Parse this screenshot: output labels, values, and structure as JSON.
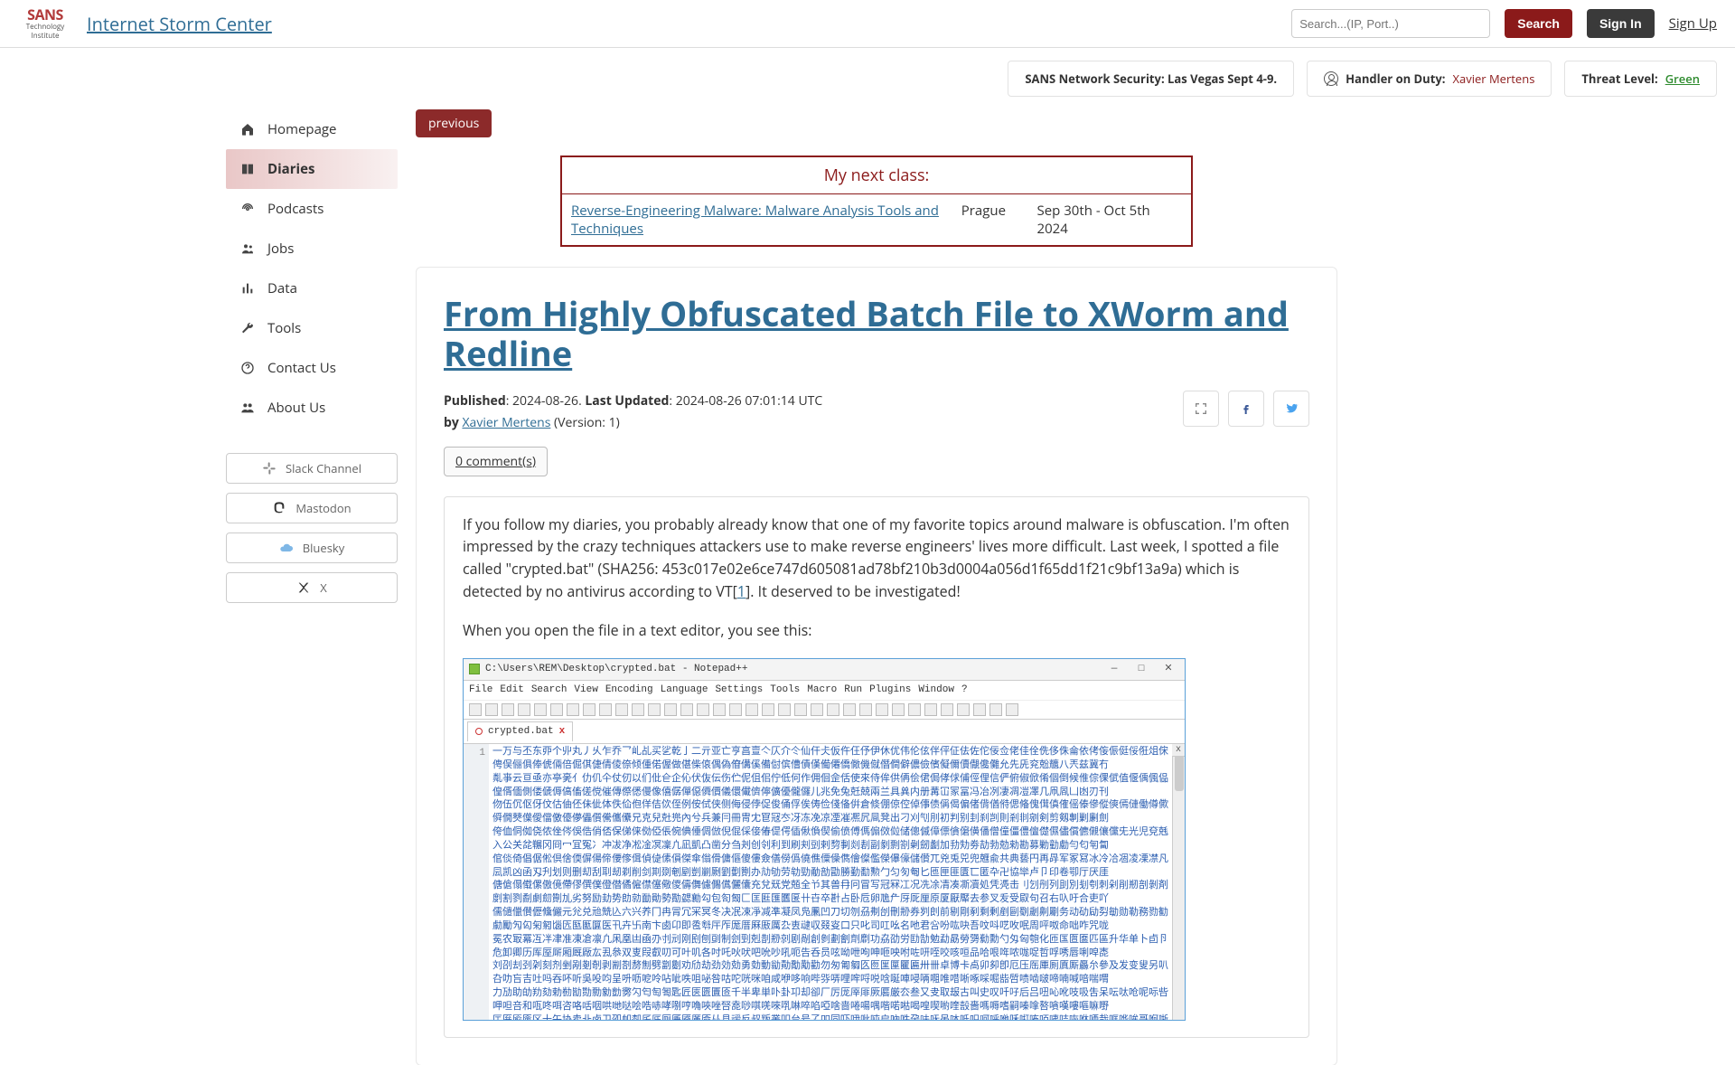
{
  "header": {
    "site_title": "Internet Storm Center",
    "logo_top": "SANS",
    "logo_mid": "Technology",
    "logo_bot": "Institute",
    "search_placeholder": "Search...(IP, Port..)",
    "search_button": "Search",
    "sign_in": "Sign In",
    "sign_up": "Sign Up"
  },
  "info_strip": {
    "promo": "SANS Network Security: Las Vegas Sept 4-9.",
    "handler_label": "Handler on Duty:",
    "handler_name": "Xavier Mertens",
    "threat_label": "Threat Level:",
    "threat_value": "Green"
  },
  "sidebar": {
    "items": [
      {
        "label": "Homepage",
        "icon": "home-icon",
        "active": false
      },
      {
        "label": "Diaries",
        "icon": "book-icon",
        "active": true
      },
      {
        "label": "Podcasts",
        "icon": "podcast-icon",
        "active": false
      },
      {
        "label": "Jobs",
        "icon": "users-icon",
        "active": false
      },
      {
        "label": "Data",
        "icon": "chart-icon",
        "active": false
      },
      {
        "label": "Tools",
        "icon": "wrench-icon",
        "active": false
      },
      {
        "label": "Contact Us",
        "icon": "question-icon",
        "active": false
      },
      {
        "label": "About Us",
        "icon": "group-icon",
        "active": false
      }
    ],
    "socials": [
      {
        "label": "Slack Channel",
        "icon": "slack-icon"
      },
      {
        "label": "Mastodon",
        "icon": "mastodon-icon"
      },
      {
        "label": "Bluesky",
        "icon": "cloud-icon"
      },
      {
        "label": "X",
        "icon": "x-icon"
      }
    ]
  },
  "nav": {
    "previous": "previous"
  },
  "class_box": {
    "heading": "My next class:",
    "course": "Reverse-Engineering Malware: Malware Analysis Tools and Techniques",
    "city": "Prague",
    "dates": "Sep 30th - Oct 5th 2024"
  },
  "article": {
    "title": "From Highly Obfuscated Batch File to XWorm and Redline",
    "published_label": "Published",
    "published_value": "2024-08-26.",
    "updated_label": "Last Updated",
    "updated_value": "2024-08-26 07:01:14 UTC",
    "by_label": "by",
    "author": "Xavier Mertens",
    "version": "(Version: 1)",
    "comments": "0 comment(s)",
    "share": {
      "full": "fullscreen-icon",
      "fb": "facebook-icon",
      "tw": "twitter-icon"
    },
    "body_p1_a": "If you follow my diaries, you probably already know that one of my favorite topics around malware is obfuscation. I'm often impressed by the crazy techniques attackers use to make reverse engineers' lives more difficult. Last week, I spotted a file called \"crypted.bat\" (SHA256: 453c017e02e6ce747d605081ad78bf210b3d0004a056d1f65dd1f21c9bf13a9a) which is detected by no antivirus according to VT[",
    "body_ref1": "1",
    "body_p1_b": "]. It deserved to be investigated!",
    "body_p2": "When you open the file in a text editor, you see this:"
  },
  "screenshot": {
    "title": "C:\\Users\\REM\\Desktop\\crypted.bat - Notepad++",
    "menus": [
      "File",
      "Edit",
      "Search",
      "View",
      "Encoding",
      "Language",
      "Settings",
      "Tools",
      "Macro",
      "Run",
      "Plugins",
      "Window",
      "?"
    ],
    "tab_name": "crypted.bat",
    "gutter_line": "1",
    "window_controls": {
      "min": "—",
      "max": "□",
      "close": "✕"
    },
    "close_x": "x"
  }
}
